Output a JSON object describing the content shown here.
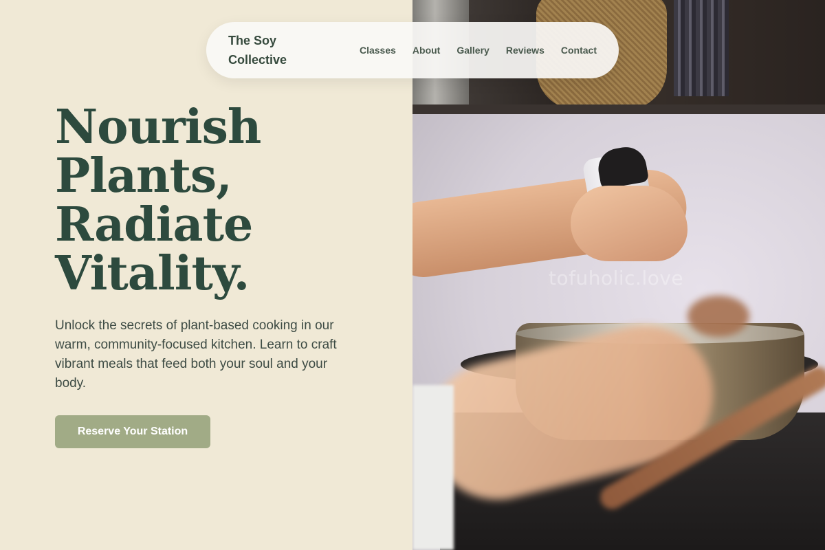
{
  "brand": {
    "name_line1": "The Soy",
    "name_line2": "Collective"
  },
  "nav": {
    "items": [
      {
        "label": "Classes"
      },
      {
        "label": "About"
      },
      {
        "label": "Gallery"
      },
      {
        "label": "Reviews"
      },
      {
        "label": "Contact"
      }
    ]
  },
  "hero": {
    "title_lines": [
      "Nourish",
      "Plants,",
      "Radiate",
      "Vitality."
    ],
    "body": "Unlock the secrets of plant-based cooking in our warm, community-focused kitchen. Learn to craft vibrant meals that feed both your soul and your body.",
    "cta_label": "Reserve Your Station"
  },
  "photo": {
    "watermark": "tofuholic.love"
  },
  "colors": {
    "background": "#f0e9d6",
    "heading": "#2d4a3e",
    "cta": "#a1ab86"
  }
}
